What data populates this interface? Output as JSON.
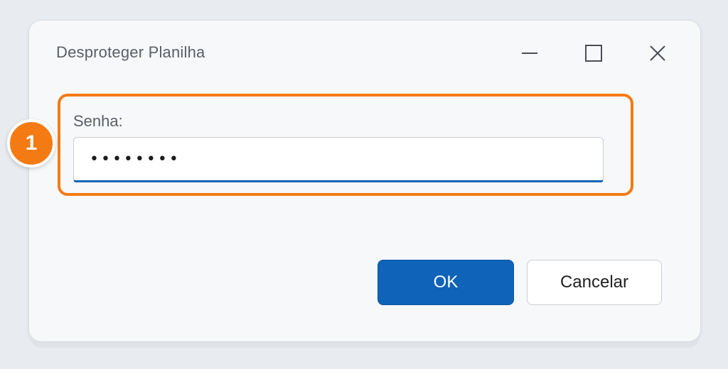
{
  "dialog": {
    "title": "Desproteger Planilha",
    "window_controls": {
      "minimize_icon": "minimize-icon",
      "maximize_icon": "maximize-icon",
      "close_icon": "close-icon"
    }
  },
  "password_field": {
    "label": "Senha:",
    "masked_value": "••••••••"
  },
  "callout": {
    "number": "1",
    "color": "#f47b14"
  },
  "buttons": {
    "ok_label": "OK",
    "cancel_label": "Cancelar"
  },
  "colors": {
    "accent": "#0f63b8",
    "highlight": "#f47b14"
  }
}
